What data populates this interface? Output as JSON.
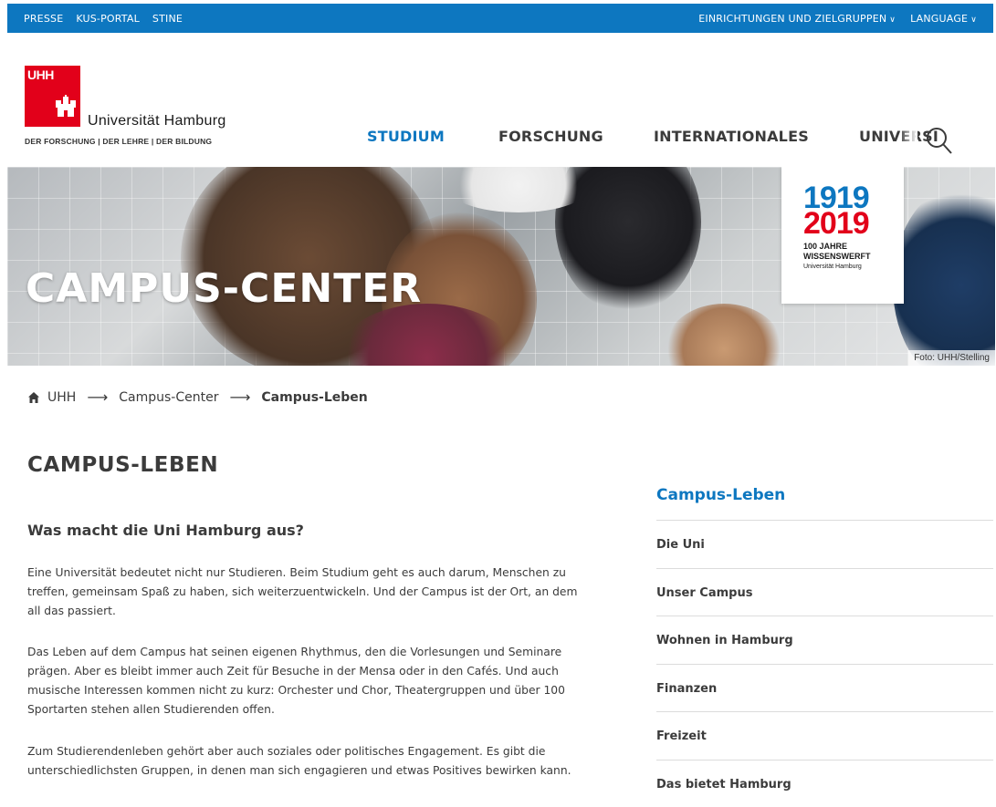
{
  "topbar": {
    "left_links": [
      "PRESSE",
      "KUS-PORTAL",
      "STINE"
    ],
    "right_links": [
      "EINRICHTUNGEN UND ZIELGRUPPEN",
      "LANGUAGE"
    ]
  },
  "header": {
    "logo_text": "UHH",
    "university_name": "Universität Hamburg",
    "tagline": "DER FORSCHUNG | DER LEHRE | DER BILDUNG"
  },
  "main_nav": [
    "STUDIUM",
    "FORSCHUNG",
    "INTERNATIONALES",
    "UNIVERSI"
  ],
  "hero": {
    "title": "CAMPUS-CENTER",
    "badge": {
      "year_top": "1919",
      "year_bottom": "2019",
      "line1": "100 JAHRE",
      "line2": "WISSENSWERFT",
      "line3": "Universität Hamburg"
    },
    "credit": "Foto: UHH/Stelling"
  },
  "breadcrumb": [
    "UHH",
    "Campus-Center",
    "Campus-Leben"
  ],
  "content": {
    "page_title": "CAMPUS-LEBEN",
    "subtitle": "Was macht die Uni Hamburg aus?",
    "paragraphs": [
      "Eine Universität bedeutet nicht nur Studieren. Beim Studium geht es auch darum, Menschen zu treffen, gemeinsam Spaß zu haben, sich weiterzuentwickeln. Und der Campus ist der Ort, an dem all das passiert.",
      "Das Leben auf dem Campus hat seinen eigenen Rhythmus, den die Vorlesungen und Seminare prägen. Aber es bleibt immer auch Zeit für Besuche in der Mensa oder in den Cafés. Und auch musische Interessen kommen nicht zu kurz: Orchester und Chor, Theatergruppen und über 100 Sportarten stehen allen Studierenden offen.",
      "Zum Studierendenleben gehört aber auch soziales oder politisches Engagement. Es gibt die unterschiedlichsten Gruppen, in denen man sich engagieren und etwas Positives bewirken kann."
    ]
  },
  "sidebar": {
    "title": "Campus-Leben",
    "items": [
      "Die Uni",
      "Unser Campus",
      "Wohnen in Hamburg",
      "Finanzen",
      "Freizeit",
      "Das bietet Hamburg"
    ]
  },
  "colors": {
    "brand_blue": "#0d77c0",
    "brand_red": "#e2001a",
    "text": "#3b3b3b"
  }
}
